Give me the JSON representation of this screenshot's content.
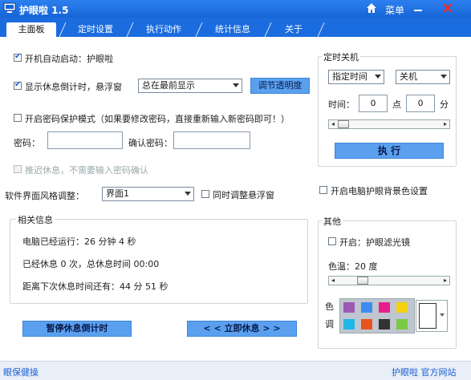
{
  "title": "护眼啦 1.5",
  "menu_label": "菜单",
  "tabs": [
    "主面板",
    "定时设置",
    "执行动作",
    "统计信息",
    "关于"
  ],
  "main": {
    "autostart_label": "开机自动启动：护眼啦",
    "autostart_checked": true,
    "countdown_label": "显示休息倒计时，悬浮窗",
    "countdown_checked": true,
    "float_position": "总在最前显示",
    "transparency_button": "调节透明度",
    "password_mode_label": "开启密码保护模式（如果要修改密码，直接重新输入新密码即可！）",
    "password_label": "密码：",
    "password_value": "",
    "confirm_password_label": "确认密码：",
    "confirm_password_value": "",
    "postpone_label": "推迟休息，不需要输入密码确认",
    "style_label": "软件界面风格调整：",
    "style_value": "界面1",
    "sync_float_label": "同时调整悬浮窗",
    "info_group_title": "相关信息",
    "info_running": "电脑已经运行：26 分钟 4 秒",
    "info_rested": "已经休息 0 次，总休息时间 00:00",
    "info_next": "距离下次休息时间还有：44 分 51 秒",
    "pause_button": "暂停休息倒计时",
    "rest_now_button": "< < 立即休息 > >"
  },
  "shutdown": {
    "group_title": "定时关机",
    "mode": "指定时间",
    "action": "关机",
    "time_label": "时间：",
    "hour_value": "0",
    "point_label": "点",
    "minute_value": "0",
    "minute_label": "分",
    "slider_value": 0,
    "execute_button": "执 行"
  },
  "bg_color_label": "开启电脑护眼背景色设置",
  "other": {
    "group_title": "其他",
    "filter_label": "开启：护眼滤光镜",
    "temp_label": "色温：20 度",
    "temp_slider_value": 0.2,
    "color_label_1": "色",
    "color_label_2": "调",
    "swatches": [
      "#9b59b6",
      "#3b8cf0",
      "#e91e8c",
      "#f5d10f",
      "#1fb8e6",
      "#e8541c",
      "#333333",
      "#7ac943"
    ]
  },
  "status_left": "眼保健操",
  "status_right": "护眼啦 官方网站"
}
